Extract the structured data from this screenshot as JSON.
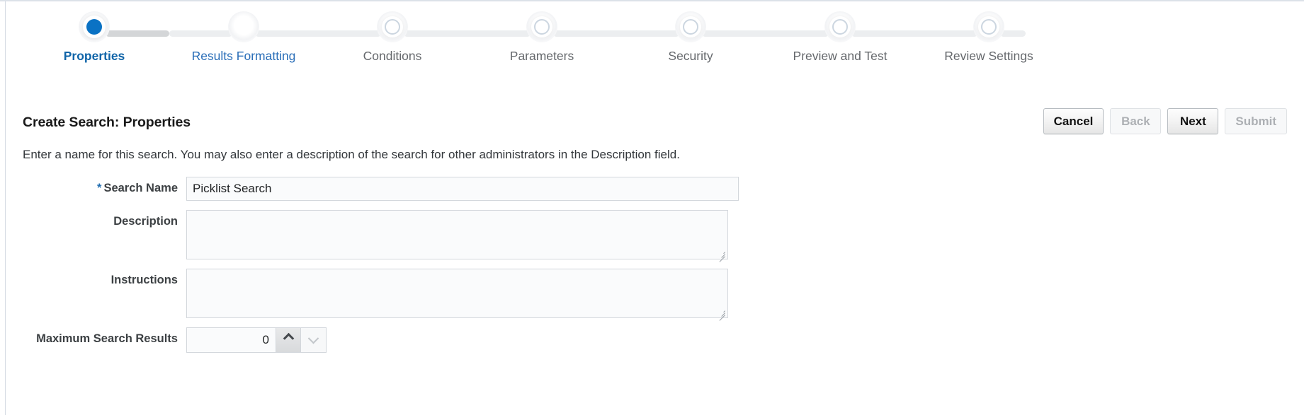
{
  "train": {
    "steps": [
      {
        "label": "Properties",
        "state": "current"
      },
      {
        "label": "Results Formatting",
        "state": "next"
      },
      {
        "label": "Conditions",
        "state": "upcoming"
      },
      {
        "label": "Parameters",
        "state": "upcoming"
      },
      {
        "label": "Security",
        "state": "upcoming"
      },
      {
        "label": "Preview and Test",
        "state": "upcoming"
      },
      {
        "label": "Review Settings",
        "state": "upcoming"
      }
    ],
    "active_color": "#0a72c4",
    "rail_done_color": "#d4d6d8",
    "rail_todo_color": "#eceef0"
  },
  "header": {
    "title": "Create Search: Properties",
    "instruction": "Enter a name for this search. You may also enter a description of the search for other administrators in the Description field."
  },
  "buttons": [
    {
      "label": "Cancel",
      "state": "enabled"
    },
    {
      "label": "Back",
      "state": "disabled"
    },
    {
      "label": "Next",
      "state": "enabled"
    },
    {
      "label": "Submit",
      "state": "disabled"
    }
  ],
  "form": {
    "search_name": {
      "label": "Search Name",
      "required_marker": "*",
      "value": "Picklist Search",
      "placeholder": ""
    },
    "description": {
      "label": "Description",
      "value": "",
      "placeholder": ""
    },
    "instructions": {
      "label": "Instructions",
      "value": "",
      "placeholder": ""
    },
    "maximum_search_results": {
      "label": "Maximum Search Results",
      "value": "0",
      "placeholder": "",
      "increment_icon": "chevron-up-icon",
      "decrement_icon": "chevron-down-icon"
    }
  }
}
